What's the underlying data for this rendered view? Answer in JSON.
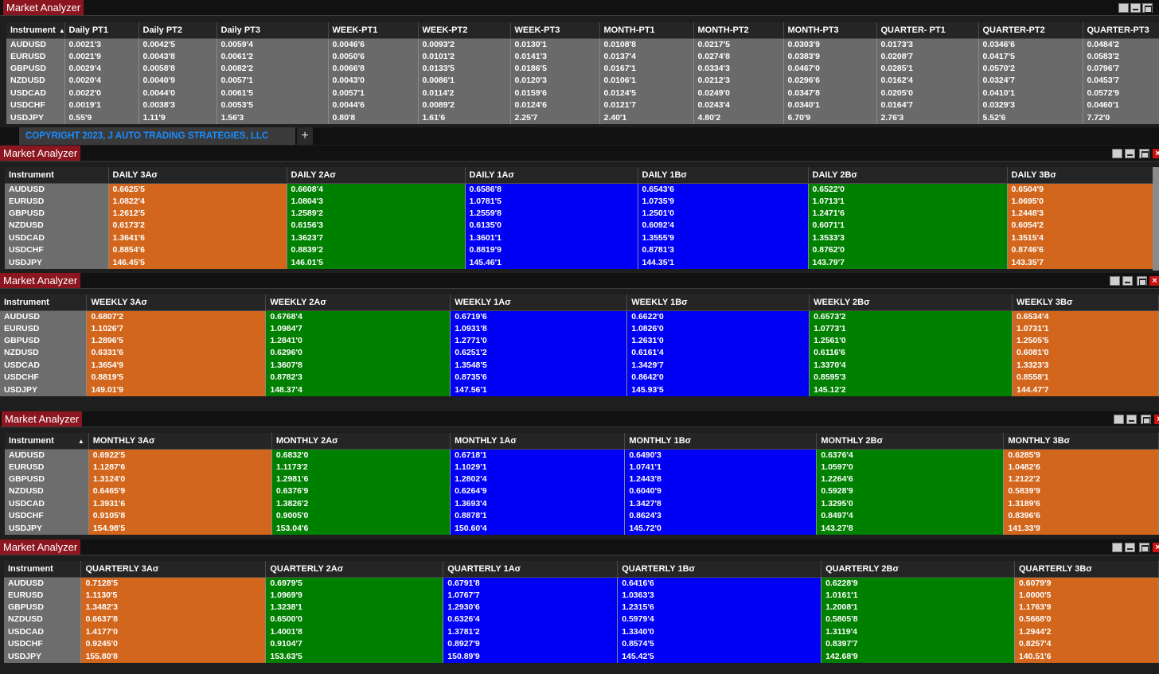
{
  "app_title": "Market Analyzer",
  "colors": {
    "orange": "#d2661c",
    "green": "#008000",
    "blue": "#0000f5",
    "title_bg": "#8c1620"
  },
  "instruments": [
    "AUDUSD",
    "EURUSD",
    "GBPUSD",
    "NZDUSD",
    "USDCAD",
    "USDCHF",
    "USDJPY"
  ],
  "copyright": "COPYRIGHT 2023, J AUTO TRADING STRATEGIES, LLC",
  "add_tab": "+",
  "sort_icon": "▲",
  "pivot": {
    "headers": [
      "Instrument",
      "Daily PT1",
      "Daily PT2",
      "Daily PT3",
      "WEEK-PT1",
      "WEEK-PT2",
      "WEEK-PT3",
      "MONTH-PT1",
      "MONTH-PT2",
      "MONTH-PT3",
      "QUARTER- PT1",
      "QUARTER-PT2",
      "QUARTER-PT3"
    ],
    "rows": [
      [
        "0.0021'3",
        "0.0042'5",
        "0.0059'4",
        "0.0046'6",
        "0.0093'2",
        "0.0130'1",
        "0.0108'8",
        "0.0217'5",
        "0.0303'9",
        "0.0173'3",
        "0.0346'6",
        "0.0484'2"
      ],
      [
        "0.0021'9",
        "0.0043'8",
        "0.0061'2",
        "0.0050'6",
        "0.0101'2",
        "0.0141'3",
        "0.0137'4",
        "0.0274'8",
        "0.0383'9",
        "0.0208'7",
        "0.0417'5",
        "0.0583'2"
      ],
      [
        "0.0029'4",
        "0.0058'8",
        "0.0082'2",
        "0.0066'8",
        "0.0133'5",
        "0.0186'5",
        "0.0167'1",
        "0.0334'3",
        "0.0467'0",
        "0.0285'1",
        "0.0570'2",
        "0.0796'7"
      ],
      [
        "0.0020'4",
        "0.0040'9",
        "0.0057'1",
        "0.0043'0",
        "0.0086'1",
        "0.0120'3",
        "0.0106'1",
        "0.0212'3",
        "0.0296'6",
        "0.0162'4",
        "0.0324'7",
        "0.0453'7"
      ],
      [
        "0.0022'0",
        "0.0044'0",
        "0.0061'5",
        "0.0057'1",
        "0.0114'2",
        "0.0159'6",
        "0.0124'5",
        "0.0249'0",
        "0.0347'8",
        "0.0205'0",
        "0.0410'1",
        "0.0572'9"
      ],
      [
        "0.0019'1",
        "0.0038'3",
        "0.0053'5",
        "0.0044'6",
        "0.0089'2",
        "0.0124'6",
        "0.0121'7",
        "0.0243'4",
        "0.0340'1",
        "0.0164'7",
        "0.0329'3",
        "0.0460'1"
      ],
      [
        "0.55'9",
        "1.11'9",
        "1.56'3",
        "0.80'8",
        "1.61'6",
        "2.25'7",
        "2.40'1",
        "4.80'2",
        "6.70'9",
        "2.76'3",
        "5.52'6",
        "7.72'0"
      ]
    ]
  },
  "panels": [
    {
      "headers": [
        "Instrument",
        "DAILY 3Aσ",
        "DAILY 2Aσ",
        "DAILY 1Aσ",
        "DAILY 1Bσ",
        "DAILY 2Bσ",
        "DAILY 3Bσ"
      ],
      "rows": [
        [
          "0.6625'5",
          "0.6608'4",
          "0.6586'8",
          "0.6543'6",
          "0.6522'0",
          "0.6504'9"
        ],
        [
          "1.0822'4",
          "1.0804'3",
          "1.0781'5",
          "1.0735'9",
          "1.0713'1",
          "1.0695'0"
        ],
        [
          "1.2612'5",
          "1.2589'2",
          "1.2559'8",
          "1.2501'0",
          "1.2471'6",
          "1.2448'3"
        ],
        [
          "0.6173'2",
          "0.6156'3",
          "0.6135'0",
          "0.6092'4",
          "0.6071'1",
          "0.6054'2"
        ],
        [
          "1.3641'6",
          "1.3623'7",
          "1.3601'1",
          "1.3555'9",
          "1.3533'3",
          "1.3515'4"
        ],
        [
          "0.8854'6",
          "0.8839'2",
          "0.8819'9",
          "0.8781'3",
          "0.8762'0",
          "0.8746'6"
        ],
        [
          "146.45'5",
          "146.01'5",
          "145.46'1",
          "144.35'1",
          "143.79'7",
          "143.35'7"
        ]
      ]
    },
    {
      "headers": [
        "Instrument",
        "WEEKLY 3Aσ",
        "WEEKLY 2Aσ",
        "WEEKLY 1Aσ",
        "WEEKLY 1Bσ",
        "WEEKLY 2Bσ",
        "WEEKLY 3Bσ"
      ],
      "rows": [
        [
          "0.6807'2",
          "0.6768'4",
          "0.6719'6",
          "0.6622'0",
          "0.6573'2",
          "0.6534'4"
        ],
        [
          "1.1026'7",
          "1.0984'7",
          "1.0931'8",
          "1.0826'0",
          "1.0773'1",
          "1.0731'1"
        ],
        [
          "1.2896'5",
          "1.2841'0",
          "1.2771'0",
          "1.2631'0",
          "1.2561'0",
          "1.2505'5"
        ],
        [
          "0.6331'6",
          "0.6296'0",
          "0.6251'2",
          "0.6161'4",
          "0.6116'6",
          "0.6081'0"
        ],
        [
          "1.3654'9",
          "1.3607'8",
          "1.3548'5",
          "1.3429'7",
          "1.3370'4",
          "1.3323'3"
        ],
        [
          "0.8819'5",
          "0.8782'3",
          "0.8735'6",
          "0.8642'0",
          "0.8595'3",
          "0.8558'1"
        ],
        [
          "149.01'9",
          "148.37'4",
          "147.56'1",
          "145.93'5",
          "145.12'2",
          "144.47'7"
        ]
      ]
    },
    {
      "headers": [
        "Instrument",
        "MONTHLY 3Aσ",
        "MONTHLY 2Aσ",
        "MONTHLY 1Aσ",
        "MONTHLY 1Bσ",
        "MONTHLY 2Bσ",
        "MONTHLY 3Bσ"
      ],
      "rows": [
        [
          "0.6922'5",
          "0.6832'0",
          "0.6718'1",
          "0.6490'3",
          "0.6376'4",
          "0.6285'9"
        ],
        [
          "1.1287'6",
          "1.1173'2",
          "1.1029'1",
          "1.0741'1",
          "1.0597'0",
          "1.0482'6"
        ],
        [
          "1.3124'0",
          "1.2981'6",
          "1.2802'4",
          "1.2443'8",
          "1.2264'6",
          "1.2122'2"
        ],
        [
          "0.6465'9",
          "0.6376'9",
          "0.6264'9",
          "0.6040'9",
          "0.5928'9",
          "0.5839'9"
        ],
        [
          "1.3931'6",
          "1.3826'2",
          "1.3693'4",
          "1.3427'8",
          "1.3295'0",
          "1.3189'6"
        ],
        [
          "0.9105'8",
          "0.9005'0",
          "0.8878'1",
          "0.8624'3",
          "0.8497'4",
          "0.8396'6"
        ],
        [
          "154.98'5",
          "153.04'6",
          "150.60'4",
          "145.72'0",
          "143.27'8",
          "141.33'9"
        ]
      ]
    },
    {
      "headers": [
        "Instrument",
        "QUARTERLY 3Aσ",
        "QUARTERLY 2Aσ",
        "QUARTERLY 1Aσ",
        "QUARTERLY 1Bσ",
        "QUARTERLY 2Bσ",
        "QUARTERLY 3Bσ"
      ],
      "rows": [
        [
          "0.7128'5",
          "0.6979'5",
          "0.6791'8",
          "0.6416'6",
          "0.6228'9",
          "0.6079'9"
        ],
        [
          "1.1130'5",
          "1.0969'9",
          "1.0767'7",
          "1.0363'3",
          "1.0161'1",
          "1.0000'5"
        ],
        [
          "1.3482'3",
          "1.3238'1",
          "1.2930'6",
          "1.2315'6",
          "1.2008'1",
          "1.1763'9"
        ],
        [
          "0.6637'8",
          "0.6500'0",
          "0.6326'4",
          "0.5979'4",
          "0.5805'8",
          "0.5668'0"
        ],
        [
          "1.4177'0",
          "1.4001'8",
          "1.3781'2",
          "1.3340'0",
          "1.3119'4",
          "1.2944'2"
        ],
        [
          "0.9245'0",
          "0.9104'7",
          "0.8927'9",
          "0.8574'5",
          "0.8397'7",
          "0.8257'4"
        ],
        [
          "155.80'8",
          "153.63'5",
          "150.89'9",
          "145.42'5",
          "142.68'9",
          "140.51'6"
        ]
      ]
    }
  ]
}
